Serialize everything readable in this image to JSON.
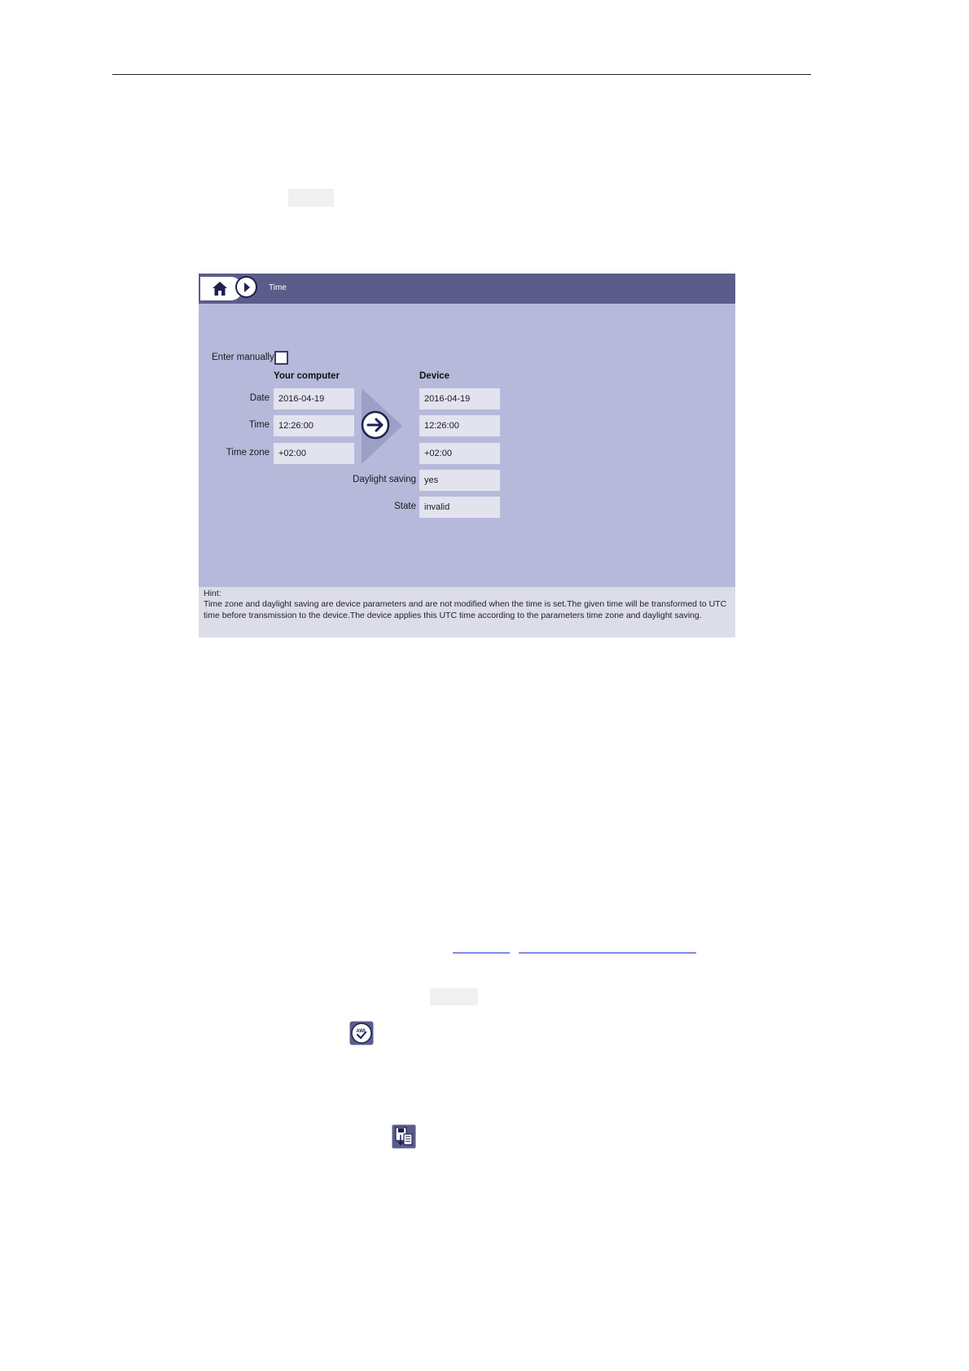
{
  "screen": {
    "title": "Time",
    "enter_manually_label": "Enter manually",
    "enter_manually_checked": false,
    "computer": {
      "header": "Your computer",
      "date_label": "Date",
      "date": "2016-04-19",
      "time_label": "Time",
      "time": "12:26:00",
      "timezone_label": "Time zone",
      "timezone": "+02:00"
    },
    "device": {
      "header": "Device",
      "date": "2016-04-19",
      "time": "12:26:00",
      "timezone": "+02:00",
      "daylight_label": "Daylight saving",
      "daylight": "yes",
      "state_label": "State",
      "state": "invalid"
    },
    "hint": {
      "label": "Hint:",
      "text": "Time zone and daylight saving are device parameters and are not modified when the time is set.The given time will be transformed to UTC time before transmission to the device.The device applies this UTC time according to the parameters time zone and daylight saving."
    }
  },
  "icons": {
    "home": "home-icon",
    "next": "chevron-right-icon",
    "transfer": "arrow-right-circle-icon",
    "awl_check": "awl-check-icon",
    "save_download": "save-download-icon"
  },
  "colors": {
    "titlebar": "#5b5c8a",
    "panel": "#b7b9db",
    "field": "#e2e3ef",
    "link": "#2233cc"
  }
}
